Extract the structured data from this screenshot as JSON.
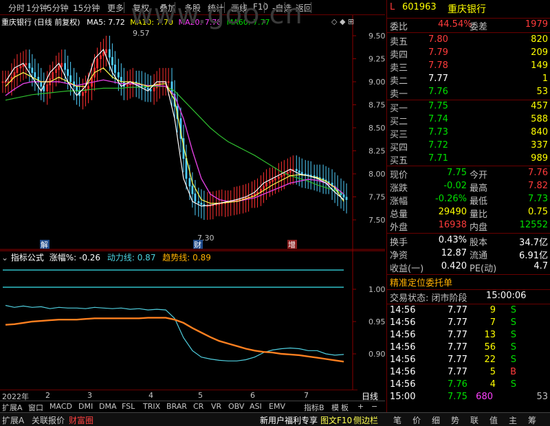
{
  "toolbar": {
    "items": [
      "分时",
      "1分钟",
      "5分钟",
      "15分钟",
      "更多",
      "复权",
      "叠加",
      "多股",
      "统计",
      "画线",
      "F10",
      "-自选",
      "返回"
    ]
  },
  "main_header": {
    "title": "重庆银行 (日线 前复权)",
    "ma5": "MA5: 7.72",
    "ma10": "MA10: 7.70",
    "ma20": "MA20: 7.78",
    "ma60": "MA60: 7.77"
  },
  "watermark": "www.goo.cn",
  "price_axis": [
    "9.50",
    "9.25",
    "9.00",
    "8.75",
    "8.50",
    "8.25",
    "8.00",
    "7.75",
    "7.50"
  ],
  "annotations": {
    "high": "9.57",
    "low": "7.30",
    "mark1": "解",
    "mark2": "财",
    "mark3": "增"
  },
  "sub_header": {
    "name": "指标公式",
    "zf": "涨幅%: -0.26",
    "dll": "动力线: 0.87",
    "qsx": "趋势线: 0.89"
  },
  "sub_axis": [
    "1.00",
    "0.95",
    "0.90"
  ],
  "dates": [
    "2022年",
    "2",
    "3",
    "4",
    "5",
    "6",
    "7"
  ],
  "date_label": "日线",
  "chart_data": {
    "type": "line",
    "ylim": [
      7.3,
      9.6
    ],
    "ma5": [
      9.0,
      9.15,
      9.2,
      9.05,
      8.9,
      9.1,
      9.2,
      9.0,
      8.85,
      8.95,
      9.25,
      9.35,
      9.1,
      8.95,
      9.0,
      8.95,
      8.9,
      9.0,
      9.0,
      8.6,
      7.95,
      7.7,
      7.65,
      7.66,
      7.68,
      7.7,
      7.72,
      7.75,
      7.8,
      7.9,
      7.95,
      8.0,
      8.05,
      8.0,
      7.98,
      7.95,
      7.9,
      7.8,
      7.72
    ],
    "ma10": [
      8.95,
      9.05,
      9.1,
      9.05,
      9.0,
      9.0,
      9.05,
      9.0,
      8.95,
      8.95,
      9.1,
      9.15,
      9.05,
      9.0,
      9.0,
      8.98,
      8.95,
      8.97,
      8.98,
      8.8,
      8.3,
      7.9,
      7.72,
      7.68,
      7.68,
      7.69,
      7.7,
      7.73,
      7.76,
      7.82,
      7.88,
      7.93,
      7.98,
      7.99,
      7.98,
      7.96,
      7.92,
      7.85,
      7.7
    ],
    "ma20": [
      8.85,
      8.92,
      8.98,
      9.0,
      9.0,
      9.0,
      9.0,
      8.98,
      8.96,
      8.98,
      9.0,
      9.02,
      9.0,
      8.98,
      8.98,
      8.97,
      8.96,
      8.96,
      8.95,
      8.85,
      8.6,
      8.25,
      7.95,
      7.78,
      7.72,
      7.7,
      7.7,
      7.72,
      7.74,
      7.78,
      7.82,
      7.86,
      7.9,
      7.92,
      7.94,
      7.93,
      7.9,
      7.86,
      7.78
    ],
    "ma60": [
      8.8,
      8.82,
      8.84,
      8.86,
      8.87,
      8.88,
      8.89,
      8.9,
      8.9,
      8.91,
      8.92,
      8.93,
      8.93,
      8.93,
      8.94,
      8.94,
      8.95,
      8.95,
      8.95,
      8.9,
      8.8,
      8.7,
      8.6,
      8.5,
      8.42,
      8.35,
      8.3,
      8.25,
      8.2,
      8.14,
      8.08,
      8.02,
      7.98,
      7.95,
      7.92,
      7.88,
      7.85,
      7.82,
      7.78
    ],
    "dll": [
      0.975,
      0.972,
      0.974,
      0.972,
      0.973,
      0.97,
      0.972,
      0.971,
      0.971,
      0.97,
      0.972,
      0.971,
      0.97,
      0.971,
      0.969,
      0.97,
      0.968,
      0.969,
      0.968,
      0.955,
      0.925,
      0.905,
      0.895,
      0.892,
      0.89,
      0.889,
      0.889,
      0.891,
      0.895,
      0.902,
      0.906,
      0.908,
      0.909,
      0.908,
      0.905,
      0.905,
      0.9,
      0.898,
      0.899
    ],
    "qsx": [
      0.945,
      0.946,
      0.948,
      0.95,
      0.951,
      0.952,
      0.953,
      0.953,
      0.953,
      0.954,
      0.955,
      0.955,
      0.955,
      0.955,
      0.955,
      0.955,
      0.956,
      0.956,
      0.956,
      0.953,
      0.948,
      0.94,
      0.933,
      0.926,
      0.92,
      0.916,
      0.912,
      0.908,
      0.905,
      0.903,
      0.902,
      0.9,
      0.899,
      0.898,
      0.896,
      0.894,
      0.892,
      0.89,
      0.888
    ]
  },
  "tabs": [
    "扩展A",
    "窗口",
    "MACD",
    "DMI",
    "DMA",
    "FSL",
    "TRIX",
    "BRAR",
    "CR",
    "VR",
    "OBV",
    "ASI",
    "EMV"
  ],
  "tabs_right": [
    "指标B",
    "模",
    "板",
    "+",
    "−"
  ],
  "bottom": {
    "items": [
      "扩展A",
      "关联报价",
      "财富圈",
      "新用户福利专享",
      "图文F10",
      "侧边栏"
    ],
    "right_icons": [
      "笔",
      "价",
      "细",
      "势",
      "联",
      "值",
      "主",
      "筹"
    ]
  },
  "quote": {
    "code": "601963",
    "name": "重庆银行",
    "tag": "L",
    "wb_label": "委比",
    "wb": "44.54%",
    "wc_label": "委差",
    "wc": "1979",
    "sells": [
      {
        "label": "卖五",
        "price": "7.80",
        "vol": "820"
      },
      {
        "label": "卖四",
        "price": "7.79",
        "vol": "209"
      },
      {
        "label": "卖三",
        "price": "7.78",
        "vol": "149"
      },
      {
        "label": "卖二",
        "price": "7.77",
        "vol": "1"
      },
      {
        "label": "卖一",
        "price": "7.76",
        "vol": "53"
      }
    ],
    "buys": [
      {
        "label": "买一",
        "price": "7.75",
        "vol": "457"
      },
      {
        "label": "买二",
        "price": "7.74",
        "vol": "588"
      },
      {
        "label": "买三",
        "price": "7.73",
        "vol": "840"
      },
      {
        "label": "买四",
        "price": "7.72",
        "vol": "337"
      },
      {
        "label": "买五",
        "price": "7.71",
        "vol": "989"
      }
    ],
    "stats": [
      [
        "现价",
        "7.75",
        "今开",
        "7.76"
      ],
      [
        "涨跌",
        "-0.02",
        "最高",
        "7.82"
      ],
      [
        "涨幅",
        "-0.26%",
        "最低",
        "7.73"
      ],
      [
        "总量",
        "29490",
        "量比",
        "0.75"
      ],
      [
        "外盘",
        "16938",
        "内盘",
        "12552"
      ]
    ],
    "stats2": [
      [
        "换手",
        "0.43%",
        "股本",
        "34.7亿"
      ],
      [
        "净资",
        "12.87",
        "流通",
        "6.91亿"
      ],
      [
        "收益(一)",
        "0.420",
        "PE(动)",
        "4.7"
      ]
    ],
    "entrust_title": "精准定位委托单",
    "trade_status": "交易状态: 闭市阶段",
    "trade_time": "15:00:06",
    "ticks": [
      [
        "14:56",
        "7.77",
        "9",
        "S"
      ],
      [
        "14:56",
        "7.77",
        "7",
        "S"
      ],
      [
        "14:56",
        "7.77",
        "13",
        "S"
      ],
      [
        "14:56",
        "7.77",
        "56",
        "S"
      ],
      [
        "14:56",
        "7.77",
        "22",
        "S"
      ],
      [
        "14:56",
        "7.77",
        "5",
        "B"
      ],
      [
        "14:56",
        "7.76",
        "4",
        "S"
      ],
      [
        "15:00",
        "7.75",
        "680",
        ""
      ]
    ]
  }
}
